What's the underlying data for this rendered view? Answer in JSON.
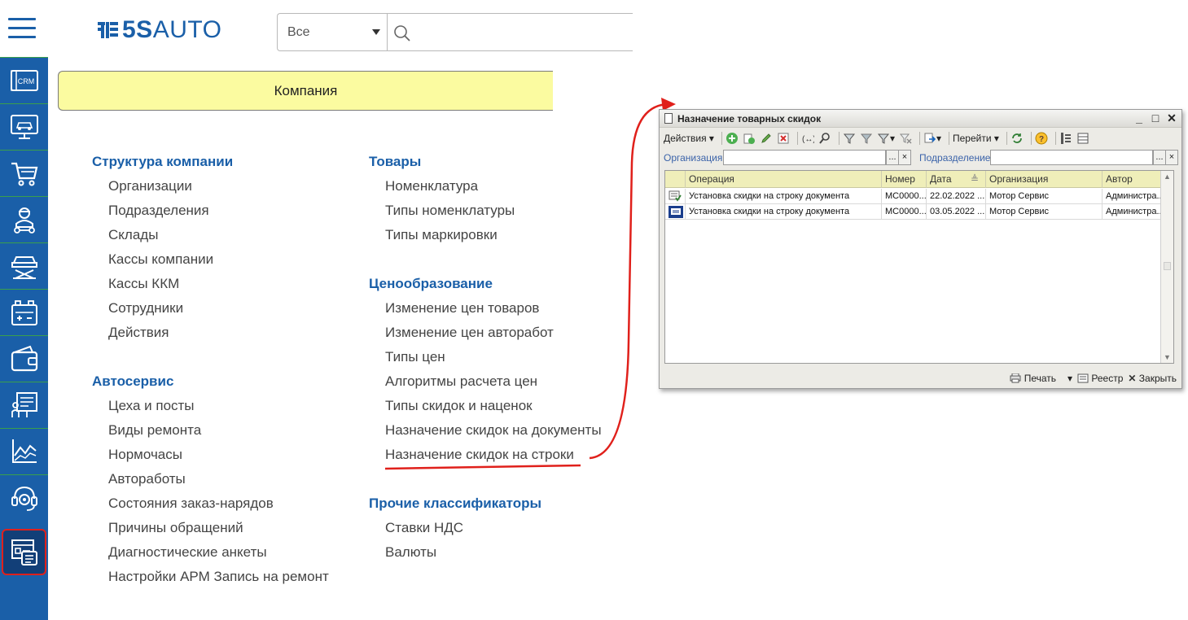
{
  "header": {
    "logo_bold": "5S",
    "logo_light": "AUTO",
    "search_scope": "Все",
    "search_placeholder": ""
  },
  "sidebar": {
    "items": [
      {
        "name": "crm",
        "label": "CRM"
      },
      {
        "name": "monitor-car",
        "label": ""
      },
      {
        "name": "cart",
        "label": ""
      },
      {
        "name": "mechanic",
        "label": ""
      },
      {
        "name": "car-lift",
        "label": ""
      },
      {
        "name": "battery",
        "label": ""
      },
      {
        "name": "wallet",
        "label": ""
      },
      {
        "name": "presentation",
        "label": ""
      },
      {
        "name": "chart",
        "label": ""
      },
      {
        "name": "support",
        "label": ""
      },
      {
        "name": "reference",
        "label": ""
      }
    ],
    "accent": "#1a5fa8",
    "active_border": "#e0201b"
  },
  "company_bar": "Компания",
  "menu": {
    "col1": [
      {
        "title": "Структура компании",
        "items": [
          "Организации",
          "Подразделения",
          "Склады",
          "Кассы компании",
          "Кассы ККМ",
          "Сотрудники",
          "Действия"
        ]
      },
      {
        "title": "Автосервис",
        "items": [
          "Цеха и посты",
          "Виды ремонта",
          "Нормочасы",
          "Автоработы",
          "Состояния заказ-нарядов",
          "Причины обращений",
          "Диагностические анкеты",
          "Настройки АРМ Запись на ремонт"
        ]
      }
    ],
    "col2": [
      {
        "title": "Товары",
        "items": [
          "Номенклатура",
          "Типы номенклатуры",
          "Типы маркировки"
        ]
      },
      {
        "title": "Ценообразование",
        "items": [
          "Изменение цен товаров",
          "Изменение цен авторабот",
          "Типы цен",
          "Алгоритмы расчета цен",
          "Типы скидок и наценок",
          "Назначение скидок на документы",
          "Назначение скидок на строки"
        ]
      },
      {
        "title": "Прочие классификаторы",
        "items": [
          "Ставки НДС",
          "Валюты"
        ]
      }
    ]
  },
  "window": {
    "title": "Назначение товарных скидок",
    "toolbar": {
      "actions": "Действия",
      "goto": "Перейти"
    },
    "filter": {
      "org_label": "Организация:",
      "dept_label": "Подразделение:",
      "dots": "...",
      "clear": "×"
    },
    "columns": [
      "Операция",
      "Номер",
      "Дата",
      "Организация",
      "Автор"
    ],
    "rows": [
      [
        "Установка скидки на строку документа",
        "МС0000...",
        "22.02.2022 ...",
        "Мотор Сервис",
        "Администра..."
      ],
      [
        "Установка скидки на строку документа",
        "МС0000...",
        "03.05.2022 ...",
        "Мотор Сервис",
        "Администра..."
      ]
    ],
    "status": {
      "print": "Печать",
      "registry": "Реестр",
      "close": "Закрыть"
    }
  }
}
